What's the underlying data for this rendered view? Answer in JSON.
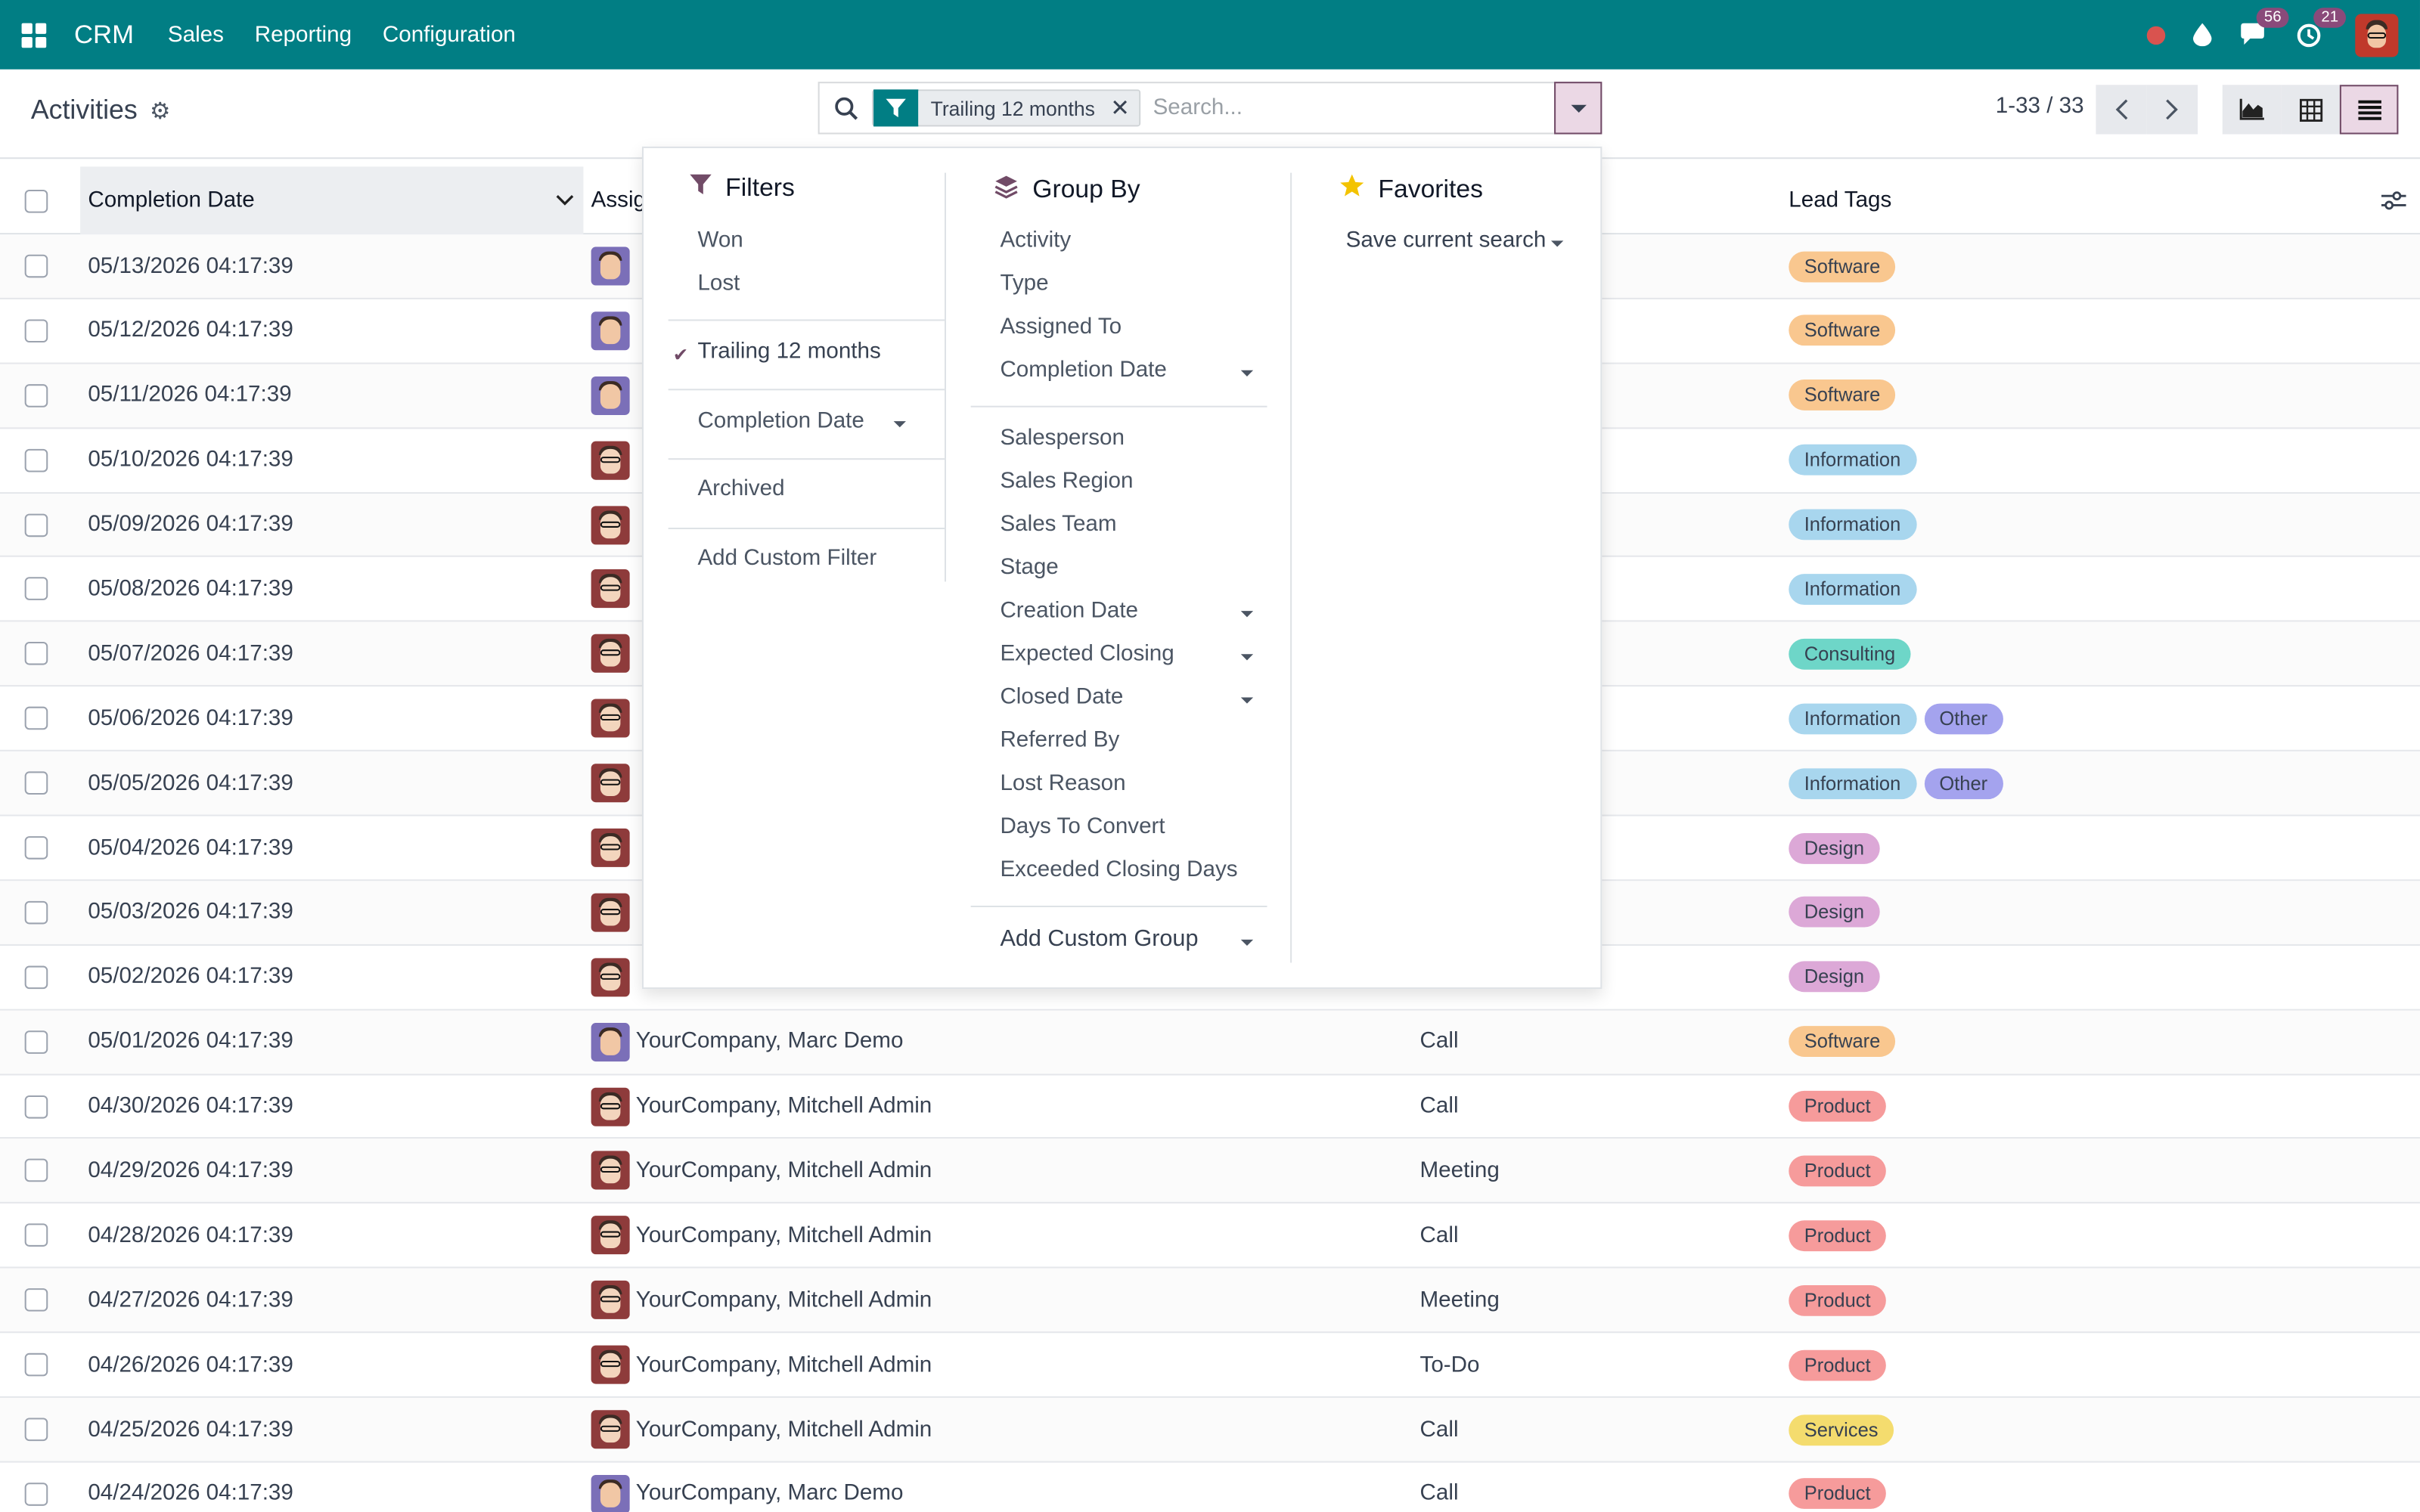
{
  "navbar": {
    "brand": "CRM",
    "menu": [
      "Sales",
      "Reporting",
      "Configuration"
    ],
    "messages_count": "56",
    "activities_count": "21"
  },
  "control_panel": {
    "title": "Activities",
    "facet_value": "Trailing 12 months",
    "search_placeholder": "Search...",
    "pager": "1-33 / 33"
  },
  "list": {
    "headers": {
      "completion_date": "Completion Date",
      "assigned": "Assig",
      "lead_tags": "Lead Tags"
    },
    "rows": [
      {
        "date": "05/13/2026 04:17:39",
        "avatar": "marc",
        "assigned": "",
        "type": "",
        "tags": [
          "Software"
        ]
      },
      {
        "date": "05/12/2026 04:17:39",
        "avatar": "marc",
        "assigned": "",
        "type": "",
        "tags": [
          "Software"
        ]
      },
      {
        "date": "05/11/2026 04:17:39",
        "avatar": "marc",
        "assigned": "",
        "type": "",
        "tags": [
          "Software"
        ]
      },
      {
        "date": "05/10/2026 04:17:39",
        "avatar": "mitch",
        "assigned": "",
        "type": "",
        "tags": [
          "Information"
        ]
      },
      {
        "date": "05/09/2026 04:17:39",
        "avatar": "mitch",
        "assigned": "",
        "type": "",
        "tags": [
          "Information"
        ]
      },
      {
        "date": "05/08/2026 04:17:39",
        "avatar": "mitch",
        "assigned": "",
        "type": "",
        "tags": [
          "Information"
        ]
      },
      {
        "date": "05/07/2026 04:17:39",
        "avatar": "mitch",
        "assigned": "",
        "type": "",
        "tags": [
          "Consulting"
        ]
      },
      {
        "date": "05/06/2026 04:17:39",
        "avatar": "mitch",
        "assigned": "",
        "type": "",
        "tags": [
          "Information",
          "Other"
        ]
      },
      {
        "date": "05/05/2026 04:17:39",
        "avatar": "mitch",
        "assigned": "",
        "type": "",
        "tags": [
          "Information",
          "Other"
        ]
      },
      {
        "date": "05/04/2026 04:17:39",
        "avatar": "mitch",
        "assigned": "",
        "type": "",
        "tags": [
          "Design"
        ]
      },
      {
        "date": "05/03/2026 04:17:39",
        "avatar": "mitch",
        "assigned": "",
        "type": "",
        "tags": [
          "Design"
        ]
      },
      {
        "date": "05/02/2026 04:17:39",
        "avatar": "mitch",
        "assigned": "",
        "type": "",
        "tags": [
          "Design"
        ]
      },
      {
        "date": "05/01/2026 04:17:39",
        "avatar": "marc",
        "assigned": "YourCompany, Marc Demo",
        "type": "Call",
        "tags": [
          "Software"
        ]
      },
      {
        "date": "04/30/2026 04:17:39",
        "avatar": "mitch",
        "assigned": "YourCompany, Mitchell Admin",
        "type": "Call",
        "tags": [
          "Product"
        ]
      },
      {
        "date": "04/29/2026 04:17:39",
        "avatar": "mitch",
        "assigned": "YourCompany, Mitchell Admin",
        "type": "Meeting",
        "tags": [
          "Product"
        ]
      },
      {
        "date": "04/28/2026 04:17:39",
        "avatar": "mitch",
        "assigned": "YourCompany, Mitchell Admin",
        "type": "Call",
        "tags": [
          "Product"
        ]
      },
      {
        "date": "04/27/2026 04:17:39",
        "avatar": "mitch",
        "assigned": "YourCompany, Mitchell Admin",
        "type": "Meeting",
        "tags": [
          "Product"
        ]
      },
      {
        "date": "04/26/2026 04:17:39",
        "avatar": "mitch",
        "assigned": "YourCompany, Mitchell Admin",
        "type": "To-Do",
        "tags": [
          "Product"
        ]
      },
      {
        "date": "04/25/2026 04:17:39",
        "avatar": "mitch",
        "assigned": "YourCompany, Mitchell Admin",
        "type": "Call",
        "tags": [
          "Services"
        ]
      },
      {
        "date": "04/24/2026 04:17:39",
        "avatar": "marc",
        "assigned": "YourCompany, Marc Demo",
        "type": "Call",
        "tags": [
          "Product"
        ]
      }
    ]
  },
  "dropdown": {
    "filters": {
      "title": "Filters",
      "won": "Won",
      "lost": "Lost",
      "trailing": "Trailing 12 months",
      "completion_date": "Completion Date",
      "archived": "Archived",
      "add_custom": "Add Custom Filter"
    },
    "group_by": {
      "title": "Group By",
      "items": [
        "Activity",
        "Type",
        "Assigned To",
        "Completion Date"
      ],
      "items2": [
        "Salesperson",
        "Sales Region",
        "Sales Team",
        "Stage",
        "Creation Date",
        "Expected Closing",
        "Closed Date",
        "Referred By",
        "Lost Reason",
        "Days To Convert",
        "Exceeded Closing Days"
      ],
      "add_custom": "Add Custom Group"
    },
    "favorites": {
      "title": "Favorites",
      "save": "Save current search"
    }
  },
  "colors": {
    "brand": "#017e84",
    "accent": "#714b67"
  }
}
